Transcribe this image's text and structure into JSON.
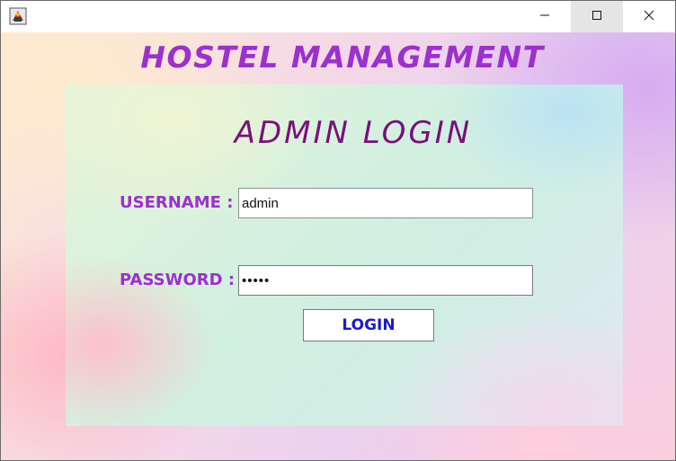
{
  "window": {
    "icon": "java-app-icon",
    "controls": [
      "minimize-icon",
      "maximize-icon",
      "close-icon"
    ]
  },
  "heading": "HOSTEL MANAGEMENT",
  "login": {
    "title": "ADMIN LOGIN",
    "username_label": "USERNAME :",
    "username_value": "admin",
    "password_label": "PASSWORD :",
    "password_value": "•••••",
    "button_label": "LOGIN"
  },
  "colors": {
    "heading": "#9b30cf",
    "title": "#7a0f7a",
    "labels": "#9b30cf",
    "button_text": "#1a1ad0"
  }
}
